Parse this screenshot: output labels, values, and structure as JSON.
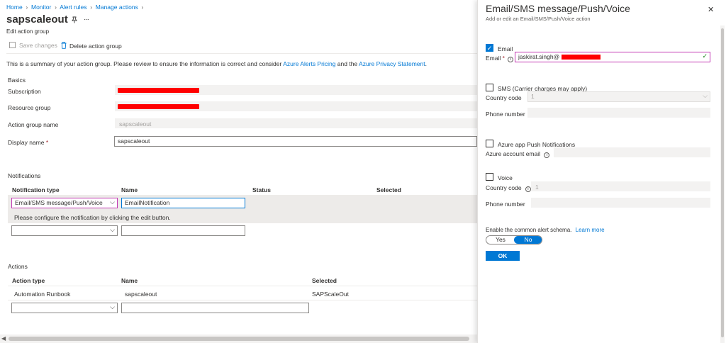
{
  "breadcrumb": [
    "Home",
    "Monitor",
    "Alert rules",
    "Manage actions"
  ],
  "page": {
    "title": "sapscaleout",
    "subtitle": "Edit action group",
    "more": "···"
  },
  "toolbar": {
    "save_label": "Save changes",
    "delete_label": "Delete action group"
  },
  "summary": {
    "text": "This is a summary of your action group. Please review to ensure the information is correct and consider ",
    "link1": "Azure Alerts Pricing",
    "mid": " and the ",
    "link2": "Azure Privacy Statement",
    "end": "."
  },
  "basics": {
    "heading": "Basics",
    "subscription_label": "Subscription",
    "resource_group_label": "Resource group",
    "action_group_name_label": "Action group name",
    "action_group_name_value": "sapscaleout",
    "display_name_label": "Display name",
    "required": "*",
    "display_name_value": "sapscaleout"
  },
  "notifications": {
    "heading": "Notifications",
    "columns": [
      "Notification type",
      "Name",
      "Status",
      "Selected"
    ],
    "row_type": "Email/SMS message/Push/Voice",
    "row_name": "EmailNotification",
    "message": "Please configure the notification by clicking the edit button."
  },
  "actions": {
    "heading": "Actions",
    "columns": [
      "Action type",
      "Name",
      "Selected"
    ],
    "row": {
      "type": "Automation Runbook",
      "name": "sapscaleout",
      "selected": "SAPScaleOut"
    }
  },
  "panel": {
    "title": "Email/SMS message/Push/Voice",
    "subtitle": "Add or edit an Email/SMS/Push/Voice action",
    "email_check": "Email",
    "email_label": "Email",
    "required": "*",
    "email_value": "jaskirat.singh@",
    "sms_check": "SMS (Carrier charges may apply)",
    "country_code_label": "Country code",
    "country_code_value": "1",
    "phone_label": "Phone number",
    "push_check": "Azure app Push Notifications",
    "azure_email_label": "Azure account email",
    "voice_check": "Voice",
    "voice_country_label": "Country code",
    "voice_country_value": "1",
    "voice_phone_label": "Phone number",
    "schema_text": "Enable the common alert schema.",
    "learn_more": "Learn more",
    "toggle_yes": "Yes",
    "toggle_no": "No",
    "ok_label": "OK",
    "close": "✕"
  },
  "colors": {
    "accent": "#0078d4",
    "redaction": "#ff0000",
    "panel_border": "#c239b3"
  }
}
